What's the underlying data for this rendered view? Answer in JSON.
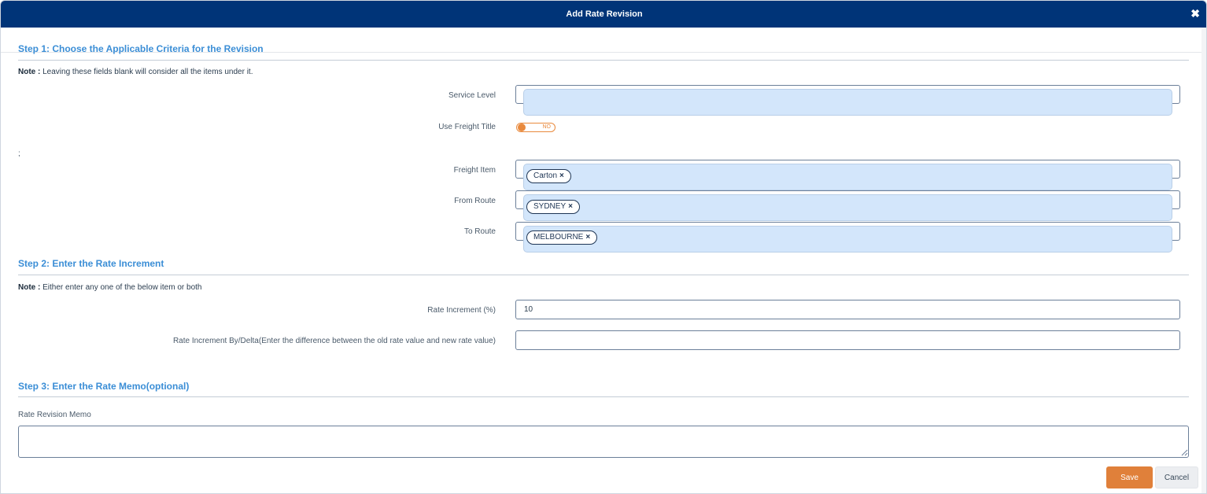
{
  "dialog": {
    "title": "Add Rate Revision",
    "close_glyph": "✖"
  },
  "step1": {
    "heading": "Step 1: Choose the Applicable Criteria for the Revision",
    "note_prefix": "Note :",
    "note_text": " Leaving these fields blank will consider all the items under it.",
    "service_level_label": "Service Level",
    "use_freight_title_label": "Use Freight Title",
    "toggle_state": "NO",
    "stray_text": ";",
    "freight_item_label": "Freight Item",
    "freight_item_tag": "Carton",
    "from_route_label": "From Route",
    "from_route_tag": "SYDNEY",
    "to_route_label": "To Route",
    "to_route_tag": "MELBOURNE",
    "tag_remove_glyph": "×"
  },
  "step2": {
    "heading": "Step 2: Enter the Rate Increment",
    "note_prefix": "Note :",
    "note_text": " Either enter any one of the below item or both",
    "rate_increment_label": "Rate Increment (%)",
    "rate_increment_value": "10",
    "rate_delta_label": "Rate Increment By/Delta(Enter the difference between the old rate value and new rate value)",
    "rate_delta_value": ""
  },
  "step3": {
    "heading": "Step 3: Enter the Rate Memo(optional)",
    "memo_label": "Rate Revision Memo",
    "memo_value": ""
  },
  "actions": {
    "save_label": "Save",
    "cancel_label": "Cancel"
  },
  "colors": {
    "header": "#003478",
    "accent": "#3b8ed6",
    "save": "#e0803a",
    "field_fill": "#d3e6fb"
  }
}
